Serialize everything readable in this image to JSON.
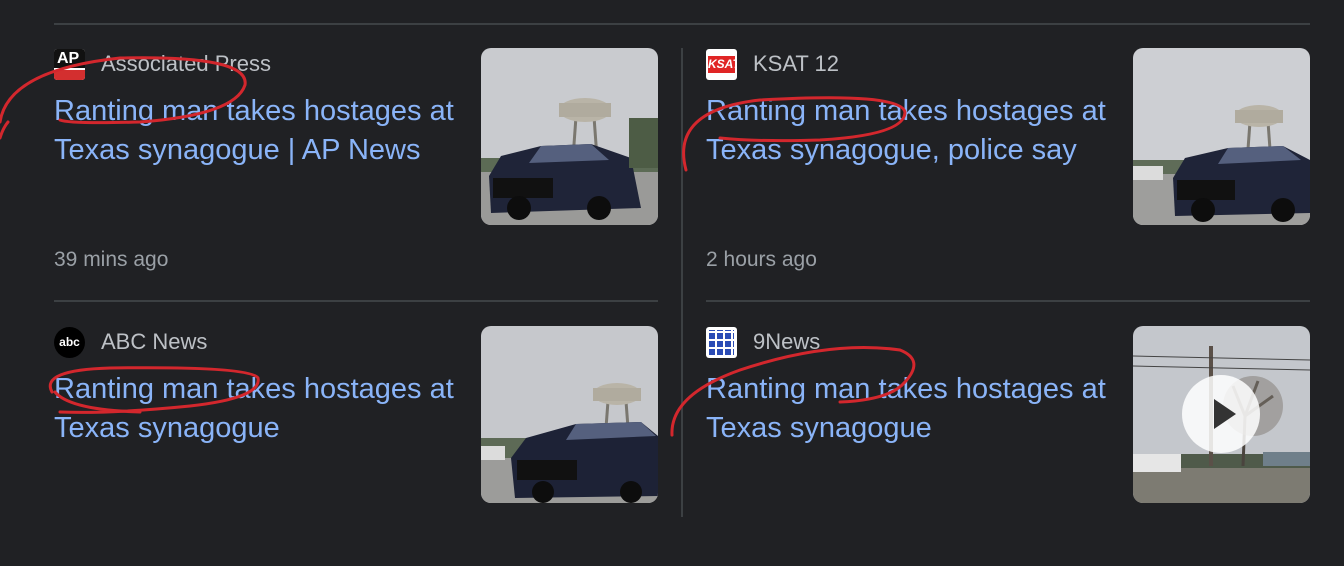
{
  "articles": [
    {
      "source": "Associated Press",
      "logo_icon": "ap-logo-icon",
      "logo_text": "AP",
      "headline": "Ranting man takes hostages at Texas synagogue | AP News",
      "time": "39 mins ago",
      "thumbnail": "police-suv-water-tower-image"
    },
    {
      "source": "KSAT 12",
      "logo_icon": "ksat-logo-icon",
      "logo_text": "KSAT",
      "headline": "Ranting man takes hostages at Texas synagogue, police say",
      "time": "2 hours ago",
      "thumbnail": "police-suv-water-tower-image"
    },
    {
      "source": "ABC News",
      "logo_icon": "abc-logo-icon",
      "logo_text": "abc",
      "headline": "Ranting man takes hostages at Texas synagogue",
      "time": "",
      "thumbnail": "police-suv-water-tower-image"
    },
    {
      "source": "9News",
      "logo_icon": "9news-logo-icon",
      "headline": "Ranting man takes hostages at Texas synagogue",
      "time": "",
      "thumbnail": "video-thumbnail-with-play-icon"
    }
  ],
  "colors": {
    "background": "#202124",
    "headline": "#8ab4f8",
    "source_text": "#bdc1c6",
    "time_text": "#9aa0a6",
    "divider": "#3c4043",
    "annotation": "#d3272d"
  }
}
